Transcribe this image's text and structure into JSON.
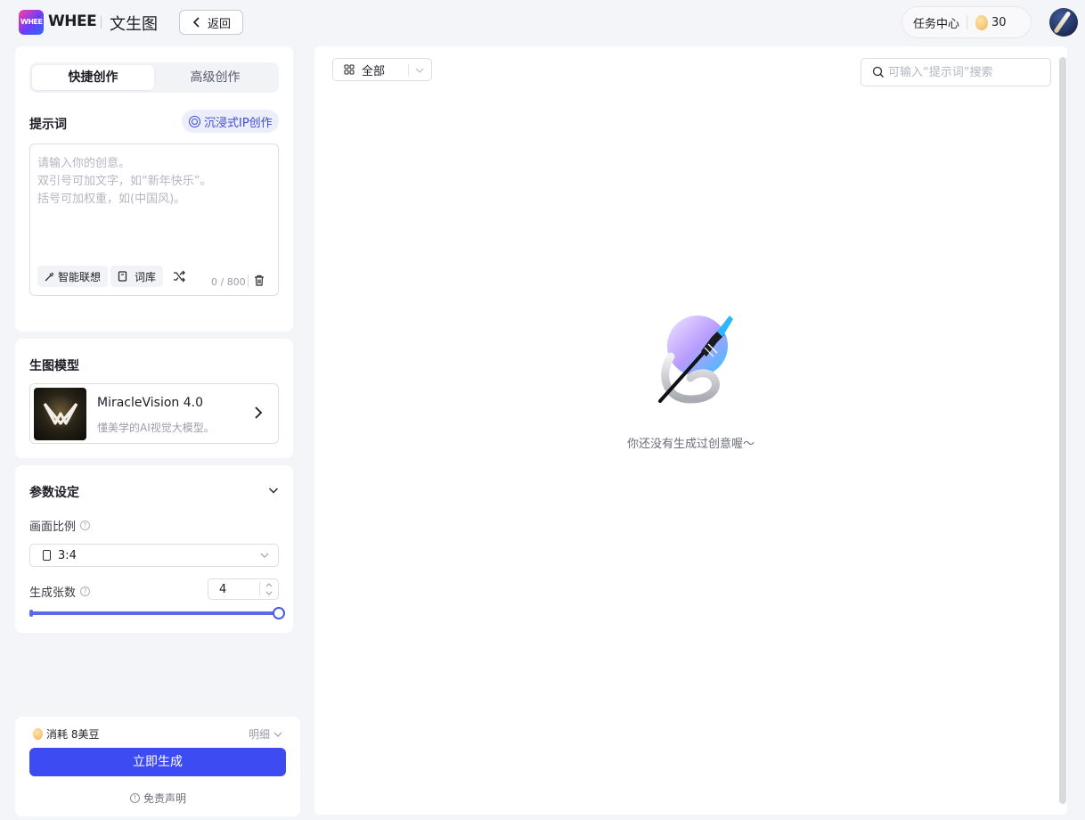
{
  "header": {
    "logo_text": "WHEE",
    "brand": "WHEE",
    "page_name": "文生图",
    "back_label": "返回",
    "task_center": "任务中心",
    "bean_count": "30"
  },
  "prompt_panel": {
    "tabs": [
      {
        "label": "快捷创作",
        "active": true
      },
      {
        "label": "高级创作",
        "active": false
      }
    ],
    "title": "提示词",
    "ip_button": "沉浸式IP创作",
    "placeholder_lines": [
      "请输入你的创意。",
      "双引号可加文字，如“新年快乐”。",
      "括号可加权重，如(中国风)。"
    ],
    "smart_button": "智能联想",
    "library_button": "词库",
    "counter": "0 / 800"
  },
  "model_panel": {
    "title": "生图模型",
    "name": "MiracleVision 4.0",
    "description": "懂美学的AI视觉大模型。"
  },
  "params_panel": {
    "title": "参数设定",
    "ratio_label": "画面比例",
    "ratio_value": "3:4",
    "count_label": "生成张数",
    "count_value": "4",
    "slider_level": 1.0
  },
  "generate": {
    "cost": "消耗 8美豆",
    "detail": "明细",
    "button": "立即生成",
    "disclaimer": "免责声明"
  },
  "gallery": {
    "filter": "全部",
    "search_placeholder": "可输入“提示词”搜索",
    "empty_text": "你还没有生成过创意喔～"
  },
  "colors": {
    "accent": "#3d4bf2",
    "slider": "#5a6ce6",
    "ip_pill_text": "#3c4bd8"
  }
}
